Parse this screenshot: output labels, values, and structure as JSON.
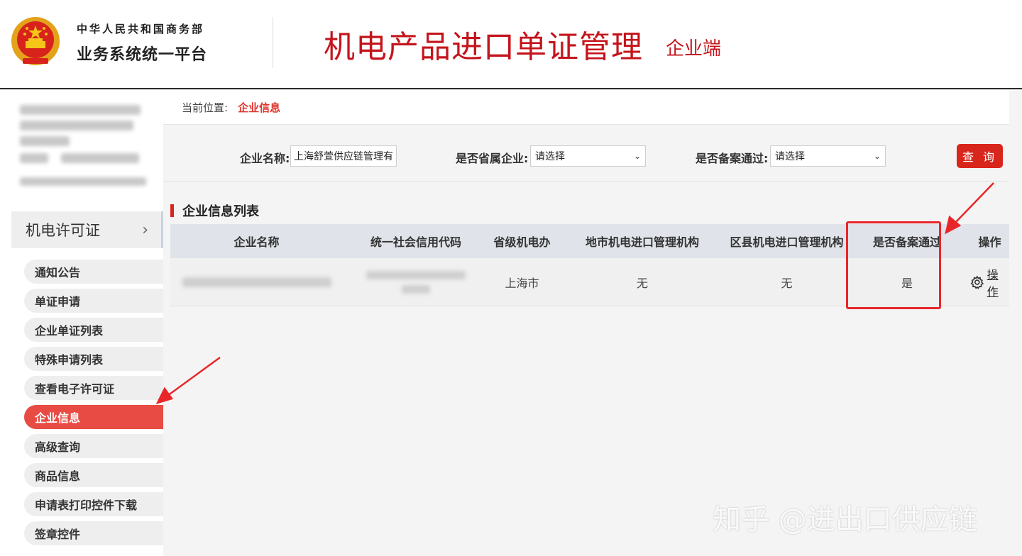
{
  "header": {
    "org_line1": "中华人民共和国商务部",
    "org_line2": "业务系统统一平台",
    "system_title": "机电产品进口单证管理",
    "system_subtitle": "企业端"
  },
  "sidebar": {
    "section_title": "机电许可证",
    "items": [
      {
        "label": "通知公告",
        "active": false
      },
      {
        "label": "单证申请",
        "active": false
      },
      {
        "label": "企业单证列表",
        "active": false
      },
      {
        "label": "特殊申请列表",
        "active": false
      },
      {
        "label": "查看电子许可证",
        "active": false
      },
      {
        "label": "企业信息",
        "active": true
      },
      {
        "label": "高级查询",
        "active": false
      },
      {
        "label": "商品信息",
        "active": false
      },
      {
        "label": "申请表打印控件下载",
        "active": false
      },
      {
        "label": "签章控件",
        "active": false
      }
    ]
  },
  "breadcrumb": {
    "label": "当前位置:",
    "current": "企业信息"
  },
  "filter": {
    "company_name_label": "企业名称:",
    "company_name_value": "上海舒萱供应链管理有",
    "provincial_label": "是否省属企业:",
    "provincial_value": "请选择",
    "filed_label": "是否备案通过:",
    "filed_value": "请选择",
    "query_button": "查 询"
  },
  "list": {
    "title": "企业信息列表",
    "columns": [
      "企业名称",
      "统一社会信用代码",
      "省级机电办",
      "地市机电进口管理机构",
      "区县机电进口管理机构",
      "是否备案通过",
      "操作"
    ],
    "rows": [
      {
        "province_office": "上海市",
        "city_agency": "无",
        "county_agency": "无",
        "filed_passed": "是",
        "action": "操作"
      }
    ]
  },
  "watermark": "知乎 @进出口供应链",
  "colors": {
    "accent_red": "#d9261c",
    "title_red": "#c4151c",
    "active_nav": "#e84b43",
    "annotation_red": "#e8262a"
  }
}
